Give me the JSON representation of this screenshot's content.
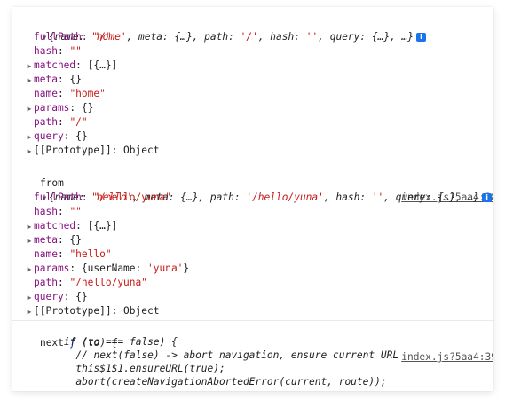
{
  "to_object": {
    "summary": [
      {
        "t": "{",
        "c": "punc"
      },
      {
        "t": "name",
        "c": "punc"
      },
      {
        "t": ": ",
        "c": "punc"
      },
      {
        "t": "'home'",
        "c": "str"
      },
      {
        "t": ", ",
        "c": "punc"
      },
      {
        "t": "meta",
        "c": "punc"
      },
      {
        "t": ": {…}, ",
        "c": "punc"
      },
      {
        "t": "path",
        "c": "punc"
      },
      {
        "t": ": ",
        "c": "punc"
      },
      {
        "t": "'/'",
        "c": "str"
      },
      {
        "t": ", ",
        "c": "punc"
      },
      {
        "t": "hash",
        "c": "punc"
      },
      {
        "t": ": ",
        "c": "punc"
      },
      {
        "t": "''",
        "c": "str"
      },
      {
        "t": ", ",
        "c": "punc"
      },
      {
        "t": "query",
        "c": "punc"
      },
      {
        "t": ": {…}, …}",
        "c": "punc"
      }
    ],
    "props": [
      {
        "arrow": false,
        "key": "fullPath",
        "value": "\"/\"",
        "vtype": "str"
      },
      {
        "arrow": false,
        "key": "hash",
        "value": "\"\"",
        "vtype": "str"
      },
      {
        "arrow": true,
        "key": "matched",
        "value": "[{…}]",
        "vtype": "punc"
      },
      {
        "arrow": true,
        "key": "meta",
        "value": "{}",
        "vtype": "punc"
      },
      {
        "arrow": false,
        "key": "name",
        "value": "\"home\"",
        "vtype": "str"
      },
      {
        "arrow": true,
        "key": "params",
        "value": "{}",
        "vtype": "punc"
      },
      {
        "arrow": false,
        "key": "path",
        "value": "\"/\"",
        "vtype": "str"
      },
      {
        "arrow": true,
        "key": "query",
        "value": "{}",
        "vtype": "punc"
      },
      {
        "arrow": true,
        "key": "[[Prototype]]",
        "value": "Object",
        "vtype": "punc",
        "plainkey": true
      }
    ]
  },
  "from_label": "from",
  "from_source": "index.js?5aa4:38",
  "from_object": {
    "summary": [
      {
        "t": "{",
        "c": "punc"
      },
      {
        "t": "name",
        "c": "punc"
      },
      {
        "t": ": ",
        "c": "punc"
      },
      {
        "t": "'hello'",
        "c": "str"
      },
      {
        "t": ", ",
        "c": "punc"
      },
      {
        "t": "meta",
        "c": "punc"
      },
      {
        "t": ": {…}, ",
        "c": "punc"
      },
      {
        "t": "path",
        "c": "punc"
      },
      {
        "t": ": ",
        "c": "punc"
      },
      {
        "t": "'/hello/yuna'",
        "c": "str"
      },
      {
        "t": ", ",
        "c": "punc"
      },
      {
        "t": "hash",
        "c": "punc"
      },
      {
        "t": ": ",
        "c": "punc"
      },
      {
        "t": "''",
        "c": "str"
      },
      {
        "t": ", ",
        "c": "punc"
      },
      {
        "t": "query",
        "c": "punc"
      },
      {
        "t": ": {…}, …}",
        "c": "punc"
      }
    ],
    "props": [
      {
        "arrow": false,
        "key": "fullPath",
        "value": "\"/hello/yuna\"",
        "vtype": "str"
      },
      {
        "arrow": false,
        "key": "hash",
        "value": "\"\"",
        "vtype": "str"
      },
      {
        "arrow": true,
        "key": "matched",
        "value": "[{…}]",
        "vtype": "punc"
      },
      {
        "arrow": true,
        "key": "meta",
        "value": "{}",
        "vtype": "punc"
      },
      {
        "arrow": false,
        "key": "name",
        "value": "\"hello\"",
        "vtype": "str"
      },
      {
        "arrow": true,
        "key": "params",
        "value": "{userName: 'yuna'}",
        "vtype": "punc",
        "rich": [
          {
            "t": "{userName: ",
            "c": "punc"
          },
          {
            "t": "'yuna'",
            "c": "str"
          },
          {
            "t": "}",
            "c": "punc"
          }
        ]
      },
      {
        "arrow": false,
        "key": "path",
        "value": "\"/hello/yuna\"",
        "vtype": "str"
      },
      {
        "arrow": true,
        "key": "query",
        "value": "{}",
        "vtype": "punc"
      },
      {
        "arrow": true,
        "key": "[[Prototype]]",
        "value": "Object",
        "vtype": "punc",
        "plainkey": true
      }
    ]
  },
  "next_prefix": "next ",
  "next_fn_kw": "ƒ",
  "next_signature": " (to) {",
  "next_source": "index.js?5aa4:39",
  "next_code": [
    "        if (to === false) {",
    "          // next(false) -> abort navigation, ensure current URL",
    "          this$1$1.ensureURL(true);",
    "          abort(createNavigationAbortedError(current, route));"
  ]
}
